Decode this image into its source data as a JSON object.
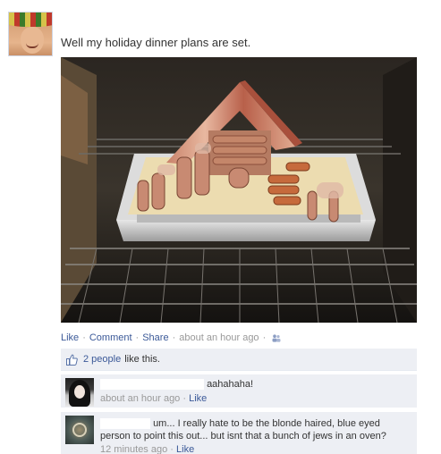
{
  "post": {
    "status_text": "Well my holiday dinner plans are set.",
    "photo_description_icon": "photo-oven-tray",
    "actions": {
      "like": "Like",
      "comment": "Comment",
      "share": "Share",
      "time": "about an hour ago",
      "separator": "·",
      "privacy_icon": "people-icon"
    }
  },
  "likes": {
    "icon": "thumbs-up-icon",
    "count_text": "2 people",
    "rest_text": "like this."
  },
  "comments": [
    {
      "text": "aahahaha!",
      "time": "about an hour ago",
      "like": "Like"
    },
    {
      "text_start": "um... I really hate to be the blonde haired, blue eyed",
      "text_rest": "person to point this out... but isnt that a bunch of jews in an oven?",
      "time": "12 minutes ago",
      "like": "Like"
    }
  ],
  "colors": {
    "link": "#3b5998",
    "meta": "#999999",
    "feedback_bg": "#edeff4"
  }
}
